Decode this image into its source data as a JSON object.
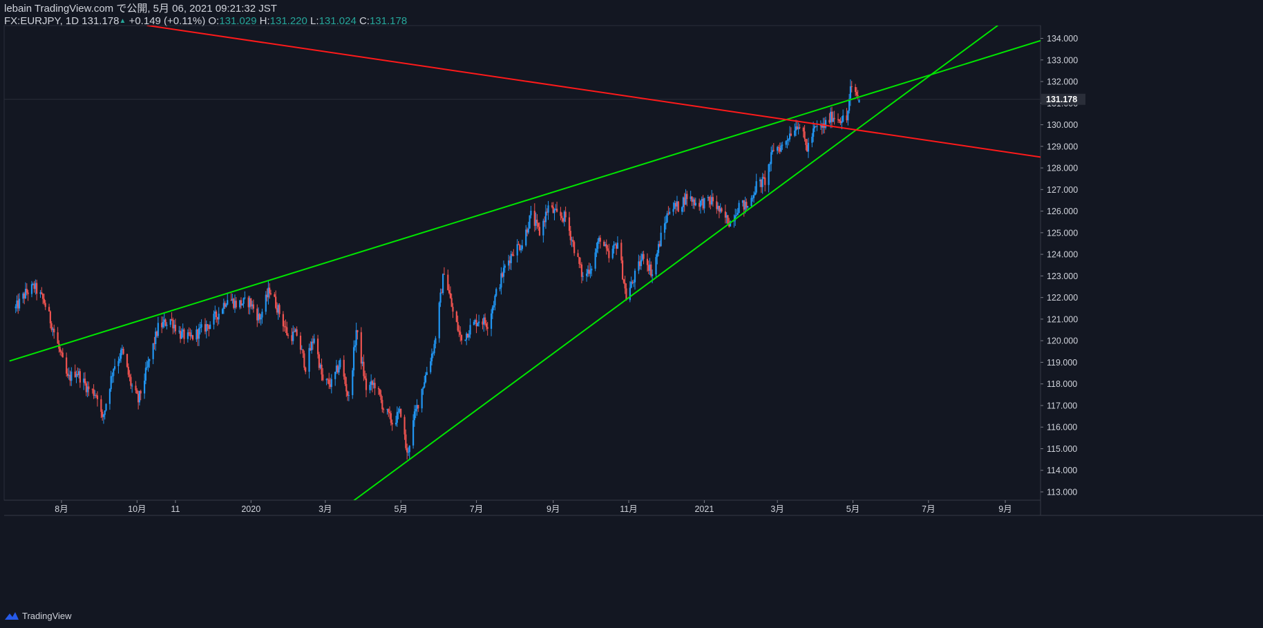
{
  "header": {
    "publish_line": "lebain TradingView.com で公開, 5月 06, 2021 09:21:32 JST",
    "symbol": "FX:EURJPY, 1D",
    "last": "131.178",
    "change": "+0.149 (+0.11%)",
    "o_label": "O:",
    "o_value": "131.029",
    "h_label": "H:",
    "h_value": "131.220",
    "l_label": "L:",
    "l_value": "131.024",
    "c_label": "C:",
    "c_value": "131.178"
  },
  "footer": {
    "brand": "TradingView"
  },
  "colors": {
    "background": "#131722",
    "up": "#2196f3",
    "down": "#ef5350",
    "support": "#00e600",
    "resistance": "#ff1a1a",
    "axis_text": "#d1d4dc"
  },
  "chart_data": {
    "type": "candlestick",
    "symbol": "FX:EURJPY",
    "timeframe": "1D",
    "ylim": [
      112.6,
      134.6
    ],
    "y_ticks": [
      "113.000",
      "114.000",
      "115.000",
      "116.000",
      "117.000",
      "118.000",
      "119.000",
      "120.000",
      "121.000",
      "122.000",
      "123.000",
      "124.000",
      "125.000",
      "126.000",
      "127.000",
      "128.000",
      "129.000",
      "130.000",
      "131.000",
      "132.000",
      "133.000",
      "134.000"
    ],
    "x_ticks": [
      {
        "label": "8月",
        "date": "2019-08-01"
      },
      {
        "label": "10月",
        "date": "2019-10-01"
      },
      {
        "label": "11",
        "date": "2019-11-01"
      },
      {
        "label": "2020",
        "date": "2020-01-01"
      },
      {
        "label": "3月",
        "date": "2020-03-01"
      },
      {
        "label": "5月",
        "date": "2020-05-01"
      },
      {
        "label": "7月",
        "date": "2020-07-01"
      },
      {
        "label": "9月",
        "date": "2020-09-01"
      },
      {
        "label": "11月",
        "date": "2020-11-01"
      },
      {
        "label": "2021",
        "date": "2021-01-01"
      },
      {
        "label": "3月",
        "date": "2021-03-01"
      },
      {
        "label": "5月",
        "date": "2021-05-01"
      },
      {
        "label": "7月",
        "date": "2021-07-01"
      },
      {
        "label": "9月",
        "date": "2021-09-01"
      }
    ],
    "last_price": "131.178",
    "closes": [
      {
        "date": "2019-06-25",
        "close": 121.5
      },
      {
        "date": "2019-07-03",
        "close": 122.2
      },
      {
        "date": "2019-07-10",
        "close": 122.5
      },
      {
        "date": "2019-07-18",
        "close": 121.8
      },
      {
        "date": "2019-07-25",
        "close": 120.6
      },
      {
        "date": "2019-08-01",
        "close": 119.2
      },
      {
        "date": "2019-08-06",
        "close": 118.2
      },
      {
        "date": "2019-08-13",
        "close": 118.6
      },
      {
        "date": "2019-08-22",
        "close": 117.8
      },
      {
        "date": "2019-08-30",
        "close": 117.5
      },
      {
        "date": "2019-09-03",
        "close": 116.3
      },
      {
        "date": "2019-09-12",
        "close": 118.8
      },
      {
        "date": "2019-09-19",
        "close": 119.5
      },
      {
        "date": "2019-09-26",
        "close": 118.0
      },
      {
        "date": "2019-10-02",
        "close": 117.2
      },
      {
        "date": "2019-10-10",
        "close": 118.9
      },
      {
        "date": "2019-10-18",
        "close": 120.6
      },
      {
        "date": "2019-10-28",
        "close": 121.0
      },
      {
        "date": "2019-11-05",
        "close": 120.3
      },
      {
        "date": "2019-11-13",
        "close": 120.1
      },
      {
        "date": "2019-11-22",
        "close": 120.5
      },
      {
        "date": "2019-11-29",
        "close": 120.8
      },
      {
        "date": "2019-12-06",
        "close": 121.3
      },
      {
        "date": "2019-12-13",
        "close": 122.0
      },
      {
        "date": "2019-12-20",
        "close": 121.7
      },
      {
        "date": "2019-12-31",
        "close": 121.8
      },
      {
        "date": "2020-01-08",
        "close": 121.0
      },
      {
        "date": "2020-01-16",
        "close": 122.4
      },
      {
        "date": "2020-01-24",
        "close": 121.3
      },
      {
        "date": "2020-01-31",
        "close": 120.2
      },
      {
        "date": "2020-02-07",
        "close": 120.3
      },
      {
        "date": "2020-02-14",
        "close": 118.8
      },
      {
        "date": "2020-02-21",
        "close": 120.2
      },
      {
        "date": "2020-02-28",
        "close": 118.1
      },
      {
        "date": "2020-03-06",
        "close": 118.0
      },
      {
        "date": "2020-03-13",
        "close": 119.0
      },
      {
        "date": "2020-03-20",
        "close": 117.3
      },
      {
        "date": "2020-03-26",
        "close": 120.5
      },
      {
        "date": "2020-04-03",
        "close": 117.8
      },
      {
        "date": "2020-04-10",
        "close": 118.0
      },
      {
        "date": "2020-04-17",
        "close": 116.9
      },
      {
        "date": "2020-04-24",
        "close": 116.2
      },
      {
        "date": "2020-05-01",
        "close": 116.7
      },
      {
        "date": "2020-05-06",
        "close": 114.7
      },
      {
        "date": "2020-05-12",
        "close": 116.5
      },
      {
        "date": "2020-05-20",
        "close": 118.2
      },
      {
        "date": "2020-05-28",
        "close": 119.8
      },
      {
        "date": "2020-06-05",
        "close": 123.3
      },
      {
        "date": "2020-06-12",
        "close": 121.3
      },
      {
        "date": "2020-06-19",
        "close": 120.0
      },
      {
        "date": "2020-06-26",
        "close": 120.6
      },
      {
        "date": "2020-07-03",
        "close": 121.0
      },
      {
        "date": "2020-07-10",
        "close": 120.8
      },
      {
        "date": "2020-07-17",
        "close": 122.2
      },
      {
        "date": "2020-07-24",
        "close": 123.4
      },
      {
        "date": "2020-07-31",
        "close": 124.2
      },
      {
        "date": "2020-08-07",
        "close": 124.5
      },
      {
        "date": "2020-08-14",
        "close": 125.8
      },
      {
        "date": "2020-08-21",
        "close": 125.0
      },
      {
        "date": "2020-08-28",
        "close": 126.2
      },
      {
        "date": "2020-09-04",
        "close": 125.8
      },
      {
        "date": "2020-09-11",
        "close": 125.7
      },
      {
        "date": "2020-09-18",
        "close": 124.3
      },
      {
        "date": "2020-09-25",
        "close": 122.9
      },
      {
        "date": "2020-10-02",
        "close": 123.5
      },
      {
        "date": "2020-10-09",
        "close": 124.8
      },
      {
        "date": "2020-10-16",
        "close": 123.8
      },
      {
        "date": "2020-10-23",
        "close": 124.6
      },
      {
        "date": "2020-10-30",
        "close": 122.0
      },
      {
        "date": "2020-11-06",
        "close": 123.0
      },
      {
        "date": "2020-11-13",
        "close": 124.0
      },
      {
        "date": "2020-11-20",
        "close": 123.1
      },
      {
        "date": "2020-11-27",
        "close": 124.8
      },
      {
        "date": "2020-12-04",
        "close": 126.2
      },
      {
        "date": "2020-12-11",
        "close": 126.2
      },
      {
        "date": "2020-12-18",
        "close": 126.7
      },
      {
        "date": "2020-12-25",
        "close": 126.4
      },
      {
        "date": "2021-01-04",
        "close": 126.4
      },
      {
        "date": "2021-01-08",
        "close": 126.5
      },
      {
        "date": "2021-01-15",
        "close": 125.8
      },
      {
        "date": "2021-01-22",
        "close": 125.5
      },
      {
        "date": "2021-01-29",
        "close": 126.3
      },
      {
        "date": "2021-02-05",
        "close": 126.2
      },
      {
        "date": "2021-02-12",
        "close": 127.2
      },
      {
        "date": "2021-02-19",
        "close": 127.4
      },
      {
        "date": "2021-02-26",
        "close": 128.9
      },
      {
        "date": "2021-03-05",
        "close": 129.0
      },
      {
        "date": "2021-03-12",
        "close": 129.7
      },
      {
        "date": "2021-03-18",
        "close": 130.1
      },
      {
        "date": "2021-03-25",
        "close": 128.9
      },
      {
        "date": "2021-03-31",
        "close": 129.8
      },
      {
        "date": "2021-04-07",
        "close": 129.9
      },
      {
        "date": "2021-04-14",
        "close": 130.4
      },
      {
        "date": "2021-04-21",
        "close": 130.3
      },
      {
        "date": "2021-04-26",
        "close": 130.2
      },
      {
        "date": "2021-04-29",
        "close": 131.6
      },
      {
        "date": "2021-05-03",
        "close": 131.5
      },
      {
        "date": "2021-05-06",
        "close": 131.2
      }
    ],
    "trendlines": [
      {
        "name": "upper",
        "color": "#00e600",
        "from": {
          "date": "2019-06-20",
          "price": 119.06
        },
        "to": {
          "date": "2021-10-20",
          "price": 134.26
        }
      },
      {
        "name": "lower",
        "color": "#00e600",
        "from": {
          "date": "2020-03-24",
          "price": 112.6
        },
        "to": {
          "date": "2021-08-26",
          "price": 134.6
        }
      },
      {
        "name": "resistance",
        "color": "#ff1a1a",
        "from": {
          "date": "2019-10-09",
          "price": 134.6
        },
        "to": {
          "date": "2021-10-20",
          "price": 128.33
        }
      }
    ]
  }
}
